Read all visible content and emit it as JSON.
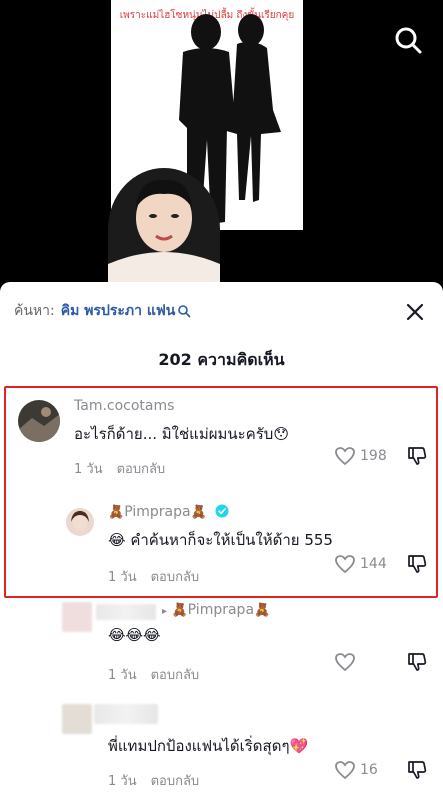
{
  "video": {
    "poster_caption": "เพราะแม่ไฮโซหนุ่มไม่ปลื้ม ถึงขั้นเรียกคุย"
  },
  "search": {
    "prefix": "ค้นหา:",
    "keyword": "คิม พรประภา แฟน"
  },
  "comments_header": {
    "title": "202 ความคิดเห็น"
  },
  "comments": [
    {
      "username": "Tam.cocotams",
      "text": "อะไรก็ด้าย... มิใช่แม่ผมนะครับ",
      "emoji": "😯",
      "time": "1 วัน",
      "reply_label": "ตอบกลับ",
      "likes": "198"
    },
    {
      "username": "Pimprapa",
      "bear": "🧸",
      "emoji_prefix": "😂",
      "text": "คำค้นหาก็จะให้เป็นให้ด้าย 555",
      "time": "1 วัน",
      "reply_label": "ตอบกลับ",
      "likes": "144"
    },
    {
      "reply_to": "Pimprapa",
      "bear": "🧸",
      "text": "😂😂😂",
      "time": "1 วัน",
      "reply_label": "ตอบกลับ",
      "likes": ""
    },
    {
      "text": "พี่แทมปกป้องแฟนได้เริ่ดสุดๆ",
      "emoji": "💖",
      "time": "1 วัน",
      "reply_label": "ตอบกลับ",
      "likes": "16"
    }
  ],
  "colors": {
    "accent_blue": "#2b5aa8",
    "highlight_red": "#e02424",
    "verified": "#20d5ec"
  }
}
